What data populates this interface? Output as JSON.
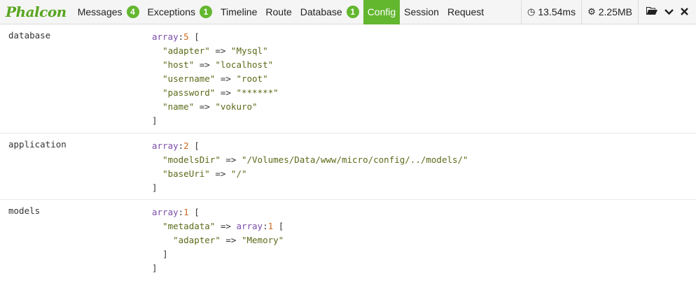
{
  "toolbar": {
    "logo": "Phalcon",
    "tabs": [
      {
        "label": "Messages",
        "badge": "4"
      },
      {
        "label": "Exceptions",
        "badge": "1"
      },
      {
        "label": "Timeline"
      },
      {
        "label": "Route"
      },
      {
        "label": "Database",
        "badge": "1"
      },
      {
        "label": "Config",
        "active": true
      },
      {
        "label": "Session"
      },
      {
        "label": "Request"
      }
    ],
    "time": "13.54ms",
    "memory": "2.25MB",
    "accent_color": "#63b72f"
  },
  "config": {
    "database": {
      "key": "database",
      "type": "array",
      "count": "5",
      "items": [
        {
          "k": "\"adapter\"",
          "v": "\"Mysql\""
        },
        {
          "k": "\"host\"",
          "v": "\"localhost\""
        },
        {
          "k": "\"username\"",
          "v": "\"root\""
        },
        {
          "k": "\"password\"",
          "v": "\"******\""
        },
        {
          "k": "\"name\"",
          "v": "\"vokuro\""
        }
      ]
    },
    "application": {
      "key": "application",
      "type": "array",
      "count": "2",
      "items": [
        {
          "k": "\"modelsDir\"",
          "v": "\"/Volumes/Data/www/micro/config/../models/\""
        },
        {
          "k": "\"baseUri\"",
          "v": "\"/\""
        }
      ]
    },
    "models": {
      "key": "models",
      "type": "array",
      "count": "1",
      "items": [
        {
          "k": "\"metadata\"",
          "type": "array",
          "count": "1",
          "items": [
            {
              "k": "\"adapter\"",
              "v": "\"Memory\""
            }
          ]
        }
      ]
    }
  },
  "syntax": {
    "arrow": "=>",
    "colon": ":",
    "open": "[",
    "close": "]"
  }
}
